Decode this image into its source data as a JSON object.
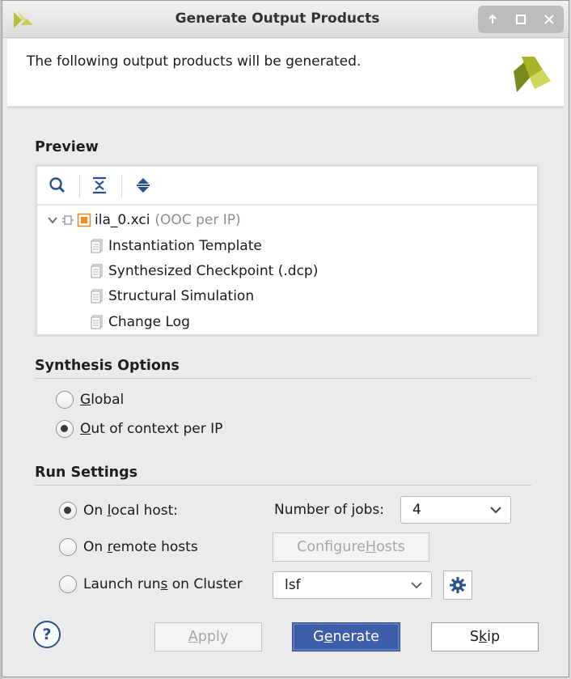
{
  "window": {
    "title": "Generate Output Products",
    "controls": [
      "restore-up-icon",
      "maximize-icon",
      "close-icon"
    ]
  },
  "header": {
    "text": "The following output products will be generated."
  },
  "preview": {
    "title": "Preview",
    "toolbar": [
      "search-icon",
      "collapse-all-icon",
      "expand-all-icon"
    ],
    "root": {
      "name": "ila_0.xci",
      "suffix": "(OOC per IP)"
    },
    "children": [
      "Instantiation Template",
      "Synthesized Checkpoint (.dcp)",
      "Structural Simulation",
      "Change Log"
    ]
  },
  "synthesis": {
    "title": "Synthesis Options",
    "options": [
      {
        "key": "G",
        "rest": "lobal",
        "checked": false
      },
      {
        "key": "O",
        "rest": "ut of context per IP",
        "checked": true
      }
    ]
  },
  "run": {
    "title": "Run Settings",
    "local": {
      "pre": "On ",
      "key": "l",
      "post": "ocal host:",
      "checked": true
    },
    "remote": {
      "pre": "On ",
      "key": "r",
      "post": "emote hosts",
      "checked": false
    },
    "cluster": {
      "pre": "Launch run",
      "key": "s",
      "post": " on Cluster",
      "checked": false
    },
    "jobs_label_pre": "Number of ",
    "jobs_label_key": "j",
    "jobs_label_post": "obs:",
    "jobs_value": "4",
    "configure_pre": "Configure ",
    "configure_key": "H",
    "configure_post": "osts",
    "cluster_value": "lsf"
  },
  "buttons": {
    "help": "?",
    "apply_key": "A",
    "apply_rest": "pply",
    "generate_pre": "G",
    "generate_key": "e",
    "generate_post": "nerate",
    "skip_pre": "S",
    "skip_key": "k",
    "skip_post": "ip"
  },
  "colors": {
    "primary_button": "#3b5fa8",
    "logo_dark": "#7a8a1e",
    "logo_light": "#c9cf4a"
  }
}
